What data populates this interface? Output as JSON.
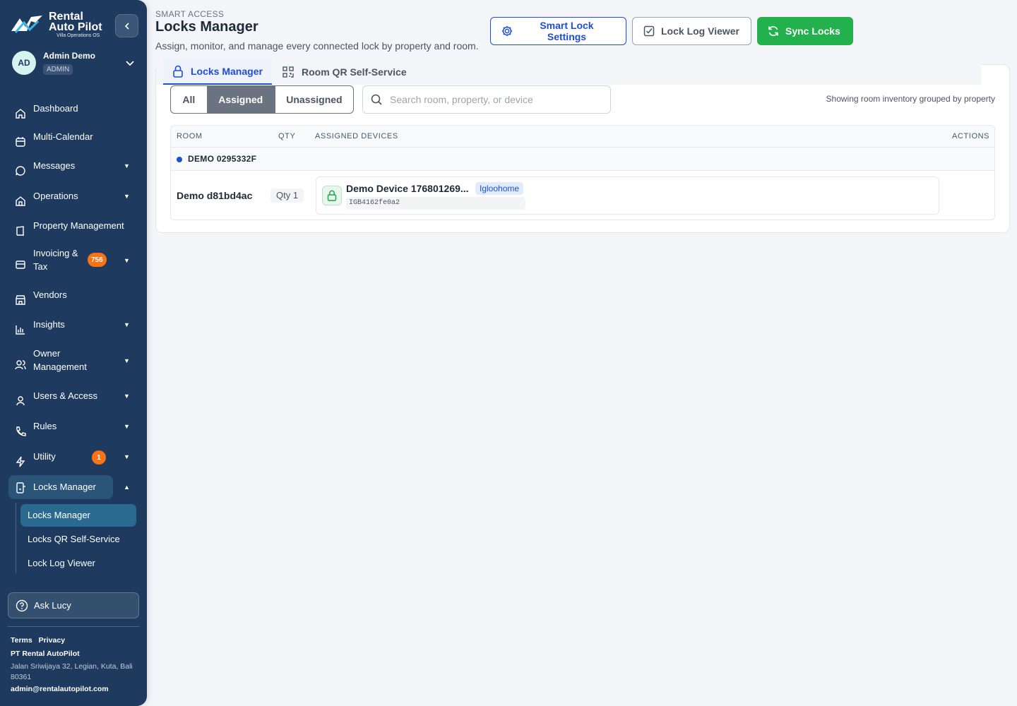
{
  "brand": {
    "name_line1": "Rental",
    "name_line2": "Auto Pilot",
    "tagline": "Villa Operations OS"
  },
  "user": {
    "initials": "AD",
    "name": "Admin Demo",
    "role": "ADMIN"
  },
  "sidebar": {
    "items": [
      {
        "label": "Dashboard",
        "icon": "home-icon"
      },
      {
        "label": "Multi-Calendar",
        "icon": "calendar-icon"
      },
      {
        "label": "Messages",
        "icon": "chat-icon"
      },
      {
        "label": "Operations",
        "icon": "operations-icon"
      },
      {
        "label": "Property Management",
        "icon": "building-icon"
      },
      {
        "label_line1": "Invoicing &",
        "label_line2": "Tax",
        "icon": "invoice-icon",
        "badge": "756"
      },
      {
        "label": "Vendors",
        "icon": "store-icon"
      },
      {
        "label": "Insights",
        "icon": "chart-icon"
      },
      {
        "label_line1": "Owner",
        "label_line2": "Management",
        "icon": "users-icon"
      },
      {
        "label": "Users & Access",
        "icon": "user-icon"
      },
      {
        "label": "Rules",
        "icon": "phone-icon"
      },
      {
        "label": "Utility",
        "icon": "bolt-icon",
        "badge": "1"
      },
      {
        "label": "Locks Manager",
        "icon": "lock-device-icon"
      }
    ],
    "sub_items": [
      "Locks Manager",
      "Locks QR Self-Service",
      "Lock Log Viewer"
    ],
    "ask_label": "Ask Lucy",
    "footer": {
      "terms": "Terms",
      "privacy": "Privacy",
      "company": "PT Rental AutoPilot",
      "address": "Jalan Sriwijaya 32, Legian, Kuta, Bali 80361",
      "email": "admin@rentalautopilot.com"
    }
  },
  "header": {
    "eyebrow": "SMART ACCESS",
    "title": "Locks Manager",
    "subtitle": "Assign, monitor, and manage every connected lock by property and room.",
    "buttons": {
      "settings": "Smart Lock Settings",
      "log": "Lock Log Viewer",
      "sync": "Sync Locks"
    }
  },
  "tabs": {
    "locks": "Locks Manager",
    "qr": "Room QR Self-Service"
  },
  "filters": {
    "all": "All",
    "assigned": "Assigned",
    "unassigned": "Unassigned",
    "selected": "Assigned",
    "search_placeholder": "Search room, property, or device",
    "search_value": "",
    "grouping_note": "Showing room inventory grouped by property"
  },
  "table": {
    "columns": [
      "ROOM",
      "QTY",
      "ASSIGNED DEVICES",
      "ACTIONS"
    ],
    "groups": [
      {
        "property": "DEMO 0295332F",
        "rooms": [
          {
            "room": "Demo d81bd4ac",
            "qty": "Qty 1",
            "device": {
              "name": "Demo Device 176801269...",
              "brand": "Igloohome",
              "serial": "IGB4162fe0a2"
            }
          }
        ]
      }
    ]
  },
  "colors": {
    "sidebar": "#1e3a5f",
    "primary": "#1d4ed8",
    "success": "#22b14c",
    "badge": "#f97316"
  }
}
